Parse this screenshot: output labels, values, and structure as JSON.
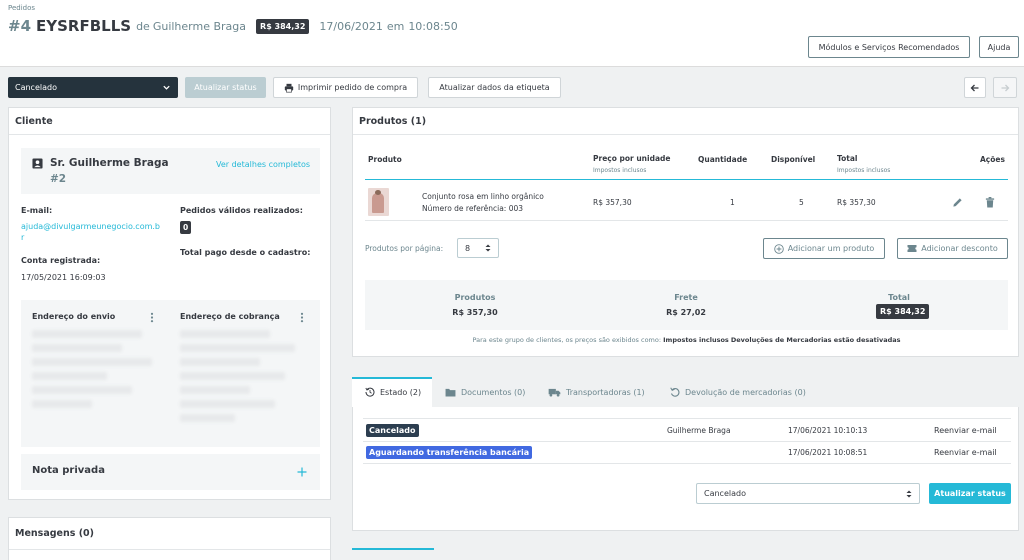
{
  "header": {
    "breadcrumb": "Pedidos",
    "order_number": "#4",
    "reference": "EYSRFBLLS",
    "de": "de",
    "customer_name": "Guilherme Braga",
    "total_badge": "R$ 384,32",
    "date": "17/06/2021",
    "em": "em",
    "time": "10:08:50",
    "modules_button": "Módulos e Serviços Recomendados",
    "help_button": "Ajuda"
  },
  "toolbar": {
    "status_value": "Cancelado",
    "update_status": "Atualizar status",
    "print_order": "Imprimir pedido de compra",
    "update_label": "Atualizar dados da etiqueta"
  },
  "customer": {
    "title": "Cliente",
    "name": "Sr. Guilherme Braga",
    "id": "#2",
    "details_link": "Ver detalhes completos",
    "email_label": "E-mail:",
    "email_line1": "ajuda@divulgarmeunegocio.com.b",
    "email_line2": "r",
    "registered_label": "Conta registrada:",
    "registered_value": "17/05/2021 16:09:03",
    "valid_orders_label": "Pedidos válidos realizados:",
    "valid_orders_count": "0",
    "total_paid_label": "Total pago desde o cadastro:",
    "shipping_address": "Endereço do envio",
    "billing_address": "Endereço de cobrança",
    "private_note": "Nota privada"
  },
  "messages": {
    "title": "Mensagens (0)"
  },
  "products": {
    "title": "Produtos (1)",
    "columns": {
      "product": "Produto",
      "unit_price": "Preço por unidade",
      "unit_price_sub": "Impostos inclusos",
      "quantity": "Quantidade",
      "available": "Disponível",
      "total": "Total",
      "total_sub": "Impostos inclusos",
      "actions": "Ações"
    },
    "row": {
      "name": "Conjunto rosa em linho orgânico",
      "reference": "Número de referência: 003",
      "unit_price": "R$ 357,30",
      "quantity": "1",
      "available": "5",
      "total": "R$ 357,30"
    },
    "per_page_label": "Produtos por página:",
    "per_page_value": "8",
    "add_product": "Adicionar um produto",
    "add_discount": "Adicionar desconto",
    "summary": {
      "products_label": "Produtos",
      "products_value": "R$ 357,30",
      "shipping_label": "Frete",
      "shipping_value": "R$ 27,02",
      "total_label": "Total",
      "total_value": "R$ 384,32"
    },
    "footnote_prefix": "Para este grupo de clientes, os preços são exibidos como:",
    "footnote_taxes": "Impostos inclusos",
    "footnote_returns": "Devoluções de Mercadorias estão desativadas"
  },
  "tabs": [
    {
      "label": "Estado (2)"
    },
    {
      "label": "Documentos (0)"
    },
    {
      "label": "Transportadoras (1)"
    },
    {
      "label": "Devolução de mercadorias (0)"
    }
  ],
  "history": [
    {
      "status": "Cancelado",
      "color": "#2c3e50",
      "employee": "Guilherme Braga",
      "date": "17/06/2021 10:10:13",
      "action": "Reenviar e-mail"
    },
    {
      "status": "Aguardando transferência bancária",
      "color": "#4169e1",
      "employee": "",
      "date": "17/06/2021 10:08:51",
      "action": "Reenviar e-mail"
    }
  ],
  "status_form": {
    "select_value": "Cancelado",
    "submit": "Atualizar status"
  },
  "colors": {
    "accent": "#25b9d7",
    "dark": "#25333d",
    "disabled": "#bbcdd2"
  }
}
